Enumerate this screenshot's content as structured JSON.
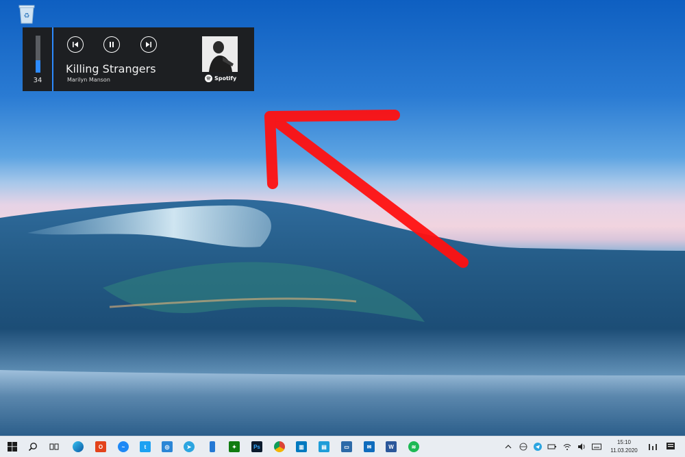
{
  "desktop": {
    "icons": [
      {
        "name": "recycle-bin",
        "label": ""
      }
    ]
  },
  "media_widget": {
    "volume": 34,
    "volume_label": "34",
    "track_title": "Killing Strangers",
    "artist": "Marilyn Manson",
    "source": "Spotify",
    "controls": [
      "previous",
      "pause",
      "next"
    ],
    "accent_color": "#2d8bff"
  },
  "annotation": {
    "arrow_color": "#ff0000",
    "direction": "up-left"
  },
  "taskbar": {
    "pinned": [
      "start",
      "search",
      "task-view",
      "edge",
      "office",
      "messenger",
      "twitter",
      "instagram",
      "telegram",
      "phone",
      "xbox",
      "photoshop",
      "chrome",
      "trello",
      "azure",
      "windows-terminal",
      "mail",
      "word",
      "spotify"
    ],
    "tray_icons": [
      "chevron-up",
      "network-app",
      "telegram",
      "battery",
      "wifi",
      "volume",
      "keyboard"
    ],
    "time": "15:10",
    "date": "11.03.2020"
  }
}
